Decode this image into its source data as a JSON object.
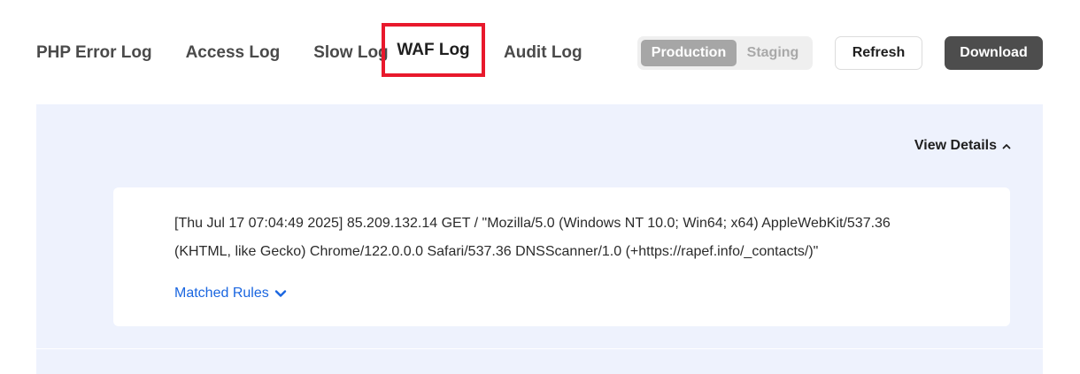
{
  "tabs": [
    {
      "label": "PHP Error Log"
    },
    {
      "label": "Access Log"
    },
    {
      "label": "Slow Log"
    },
    {
      "label": "WAF Log",
      "active": true
    },
    {
      "label": "Audit Log"
    }
  ],
  "environment": {
    "options": [
      "Production",
      "Staging"
    ],
    "selected": "Production"
  },
  "toolbar": {
    "refresh_label": "Refresh",
    "download_label": "Download"
  },
  "log": {
    "view_details_label": "View Details",
    "entry_line1": "[Thu Jul 17 07:04:49 2025] 85.209.132.14 GET / \"Mozilla/5.0 (Windows NT 10.0; Win64; x64) AppleWebKit/537.36",
    "entry_line2": "(KHTML, like Gecko) Chrome/122.0.0.0 Safari/537.36 DNSScanner/1.0 (+https://rapef.info/_contacts/)\"",
    "matched_rules_label": "Matched Rules"
  },
  "colors": {
    "highlight": "#e8192c",
    "link": "#1a66e0",
    "panel_bg": "#eef2fd",
    "download_bg": "#4d4d4d"
  },
  "icons": {
    "view_details": "chevron-up-icon",
    "matched_rules": "chevron-down-icon"
  }
}
